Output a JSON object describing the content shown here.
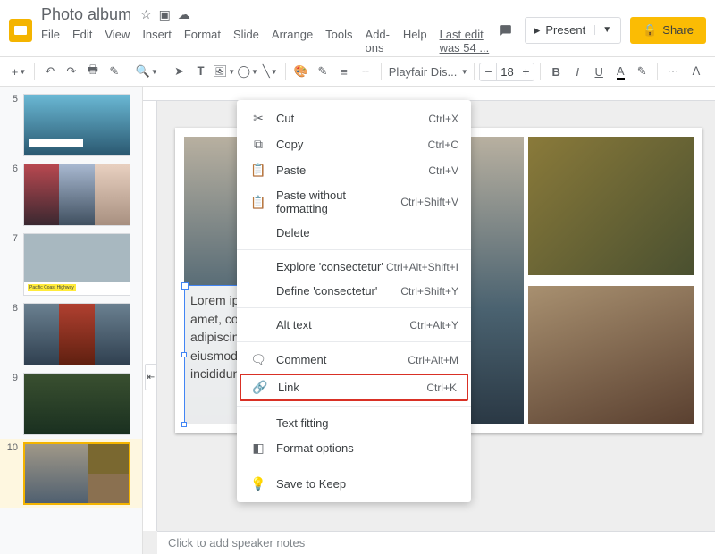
{
  "header": {
    "title": "Photo album",
    "last_edit": "Last edit was 54 ...",
    "present": "Present",
    "share": "Share"
  },
  "menubar": {
    "file": "File",
    "edit": "Edit",
    "view": "View",
    "insert": "Insert",
    "format": "Format",
    "slide": "Slide",
    "arrange": "Arrange",
    "tools": "Tools",
    "addons": "Add-ons",
    "help": "Help"
  },
  "toolbar": {
    "font": "Playfair Dis...",
    "size": "18"
  },
  "slides": {
    "s5": "5",
    "s6": "6",
    "s7": "7",
    "s8": "8",
    "s9": "9",
    "s10": "10",
    "t7_label": "Pacific Coast Highway"
  },
  "text_content": "Lorem ipsum dolor sit amet, consectetur adipiscing elit, sed do eiusmod tempor incididunt ut labore.",
  "context_menu": {
    "cut": {
      "label": "Cut",
      "shortcut": "Ctrl+X"
    },
    "copy": {
      "label": "Copy",
      "shortcut": "Ctrl+C"
    },
    "paste": {
      "label": "Paste",
      "shortcut": "Ctrl+V"
    },
    "paste_nf": {
      "label": "Paste without formatting",
      "shortcut": "Ctrl+Shift+V"
    },
    "delete": {
      "label": "Delete",
      "shortcut": ""
    },
    "explore": {
      "label": "Explore 'consectetur'",
      "shortcut": "Ctrl+Alt+Shift+I"
    },
    "define": {
      "label": "Define 'consectetur'",
      "shortcut": "Ctrl+Shift+Y"
    },
    "alt": {
      "label": "Alt text",
      "shortcut": "Ctrl+Alt+Y"
    },
    "comment": {
      "label": "Comment",
      "shortcut": "Ctrl+Alt+M"
    },
    "link": {
      "label": "Link",
      "shortcut": "Ctrl+K"
    },
    "fit": {
      "label": "Text fitting",
      "shortcut": ""
    },
    "format_opt": {
      "label": "Format options",
      "shortcut": ""
    },
    "save_keep": {
      "label": "Save to Keep",
      "shortcut": ""
    }
  },
  "speaker_notes": "Click to add speaker notes"
}
